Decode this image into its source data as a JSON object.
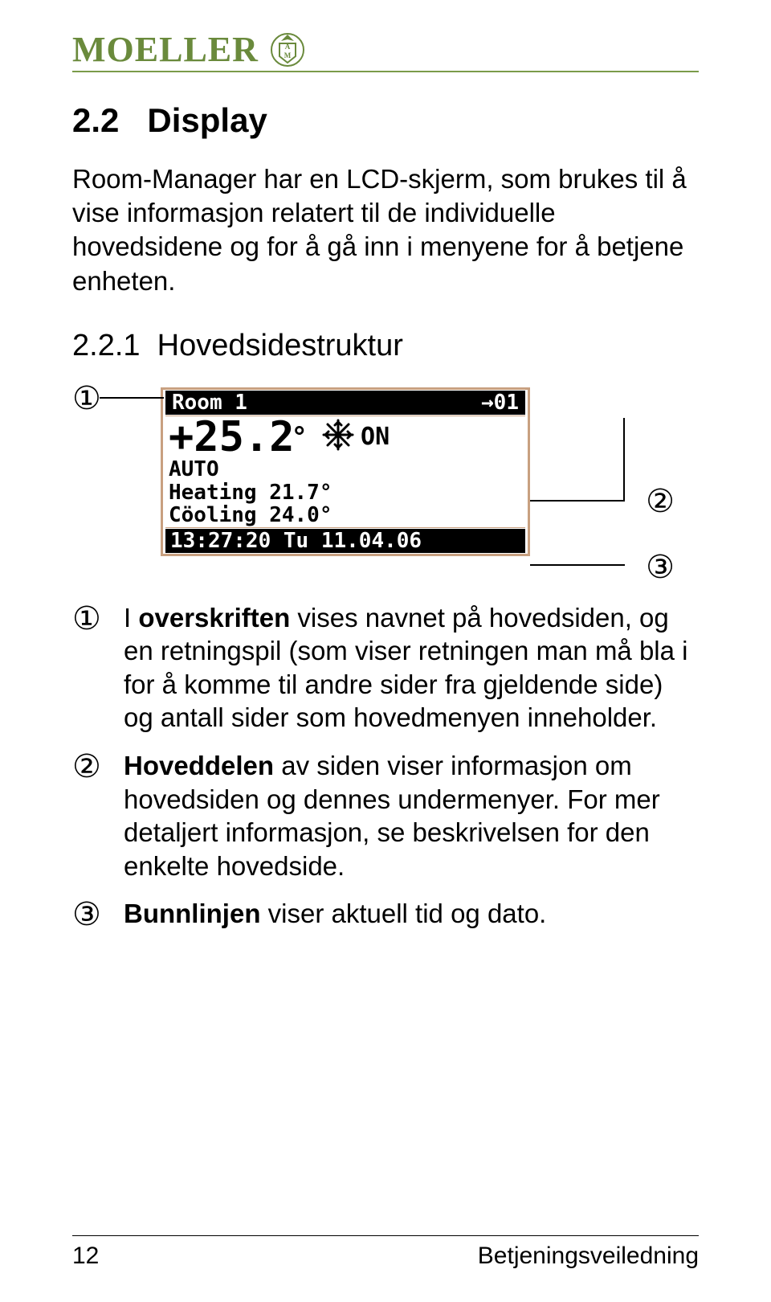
{
  "brand": {
    "name": "MOELLER"
  },
  "section": {
    "num": "2.2",
    "title": "Display"
  },
  "intro": "Room-Manager har en LCD-skjerm, som brukes til å vise informasjon relatert til de individuelle hovedsidene og for å gå inn i menyene for å betjene enheten.",
  "subsection": {
    "num": "2.2.1",
    "title": "Hovedsidestruktur"
  },
  "lcd": {
    "room_label": "Room 1",
    "page_index": "→01",
    "temp": "+25.2",
    "deg": "°",
    "state": "ON",
    "auto": "AUTO",
    "heating": "Heating 21.7°",
    "cooling": "Cöoling 24.0°",
    "statusbar": "13:27:20 Tu 11.04.06"
  },
  "markers": {
    "m1": "①",
    "m2": "②",
    "m3": "③"
  },
  "defs": [
    {
      "num": "①",
      "pre": "I ",
      "bold": "overskriften",
      "post": " vises navnet på hovedsiden, og en retningspil (som viser retningen man må bla i for å komme til andre sider fra gjeldende side) og antall sider som hovedmenyen inneholder."
    },
    {
      "num": "②",
      "pre": "",
      "bold": "Hoveddelen",
      "post": " av siden viser informasjon om hovedsiden og dennes undermenyer. For mer detaljert informasjon, se beskrivelsen for den enkelte hovedside."
    },
    {
      "num": "③",
      "pre": "",
      "bold": "Bunnlinjen",
      "post": " viser aktuell tid og dato."
    }
  ],
  "footer": {
    "page": "12",
    "title": "Betjeningsveiledning"
  }
}
